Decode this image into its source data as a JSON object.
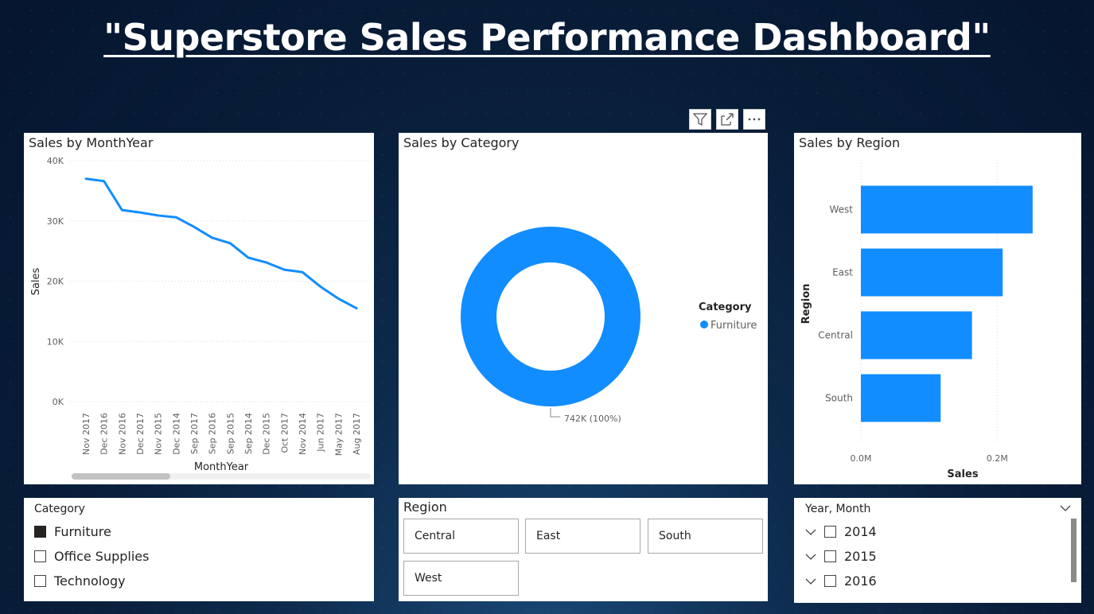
{
  "page": {
    "title": "\"Superstore Sales Performance Dashboard\""
  },
  "header_buttons": [
    {
      "icon": "filter-icon"
    },
    {
      "icon": "focus-mode-icon"
    },
    {
      "icon": "more-options-icon"
    }
  ],
  "line_visual": {
    "title": "Sales by MonthYear",
    "chart_data": {
      "type": "line",
      "title": "Sales by MonthYear",
      "xlabel": "MonthYear",
      "ylabel": "Sales",
      "ylim": [
        0,
        40000
      ],
      "y_ticks": [
        "0K",
        "10K",
        "20K",
        "30K",
        "40K"
      ],
      "categories": [
        "Nov 2017",
        "Dec 2016",
        "Nov 2016",
        "Dec 2017",
        "Nov 2015",
        "Dec 2014",
        "Sep 2017",
        "Sep 2016",
        "Sep 2015",
        "Sep 2014",
        "Dec 2015",
        "Oct 2017",
        "Nov 2014",
        "Jun 2017",
        "May 2017",
        "Aug 2017"
      ],
      "values": [
        37000,
        36600,
        31800,
        31400,
        30900,
        30600,
        29000,
        27200,
        26300,
        23900,
        23100,
        21900,
        21500,
        19100,
        17100,
        15500
      ],
      "grid": true,
      "color": "#118DFF"
    }
  },
  "donut_visual": {
    "title": "Sales by Category",
    "chart_data": {
      "type": "pie",
      "title": "Sales by Category",
      "legend_title": "Category",
      "legend_position": "right",
      "slices": [
        {
          "name": "Furniture",
          "value": 742000,
          "percent": 100,
          "label": "742K (100%)",
          "color": "#118DFF"
        }
      ]
    }
  },
  "bar_visual": {
    "title": "Sales by Region",
    "chart_data": {
      "type": "bar",
      "orientation": "horizontal",
      "title": "Sales by Region",
      "xlabel": "Sales",
      "ylabel": "Region",
      "categories": [
        "West",
        "East",
        "Central",
        "South"
      ],
      "values": [
        252000,
        208000,
        163000,
        117000
      ],
      "xlim": [
        0,
        300000
      ],
      "x_ticks": [
        "0.0M",
        "0.2M"
      ],
      "grid": true,
      "color": "#118DFF"
    }
  },
  "category_slicer": {
    "header": "Category",
    "items": [
      {
        "label": "Furniture",
        "checked": true
      },
      {
        "label": "Office Supplies",
        "checked": false
      },
      {
        "label": "Technology",
        "checked": false
      }
    ]
  },
  "region_slicer": {
    "header": "Region",
    "tiles": [
      "Central",
      "East",
      "South",
      "West"
    ]
  },
  "date_slicer": {
    "header": "Year, Month",
    "years": [
      "2014",
      "2015",
      "2016"
    ]
  }
}
